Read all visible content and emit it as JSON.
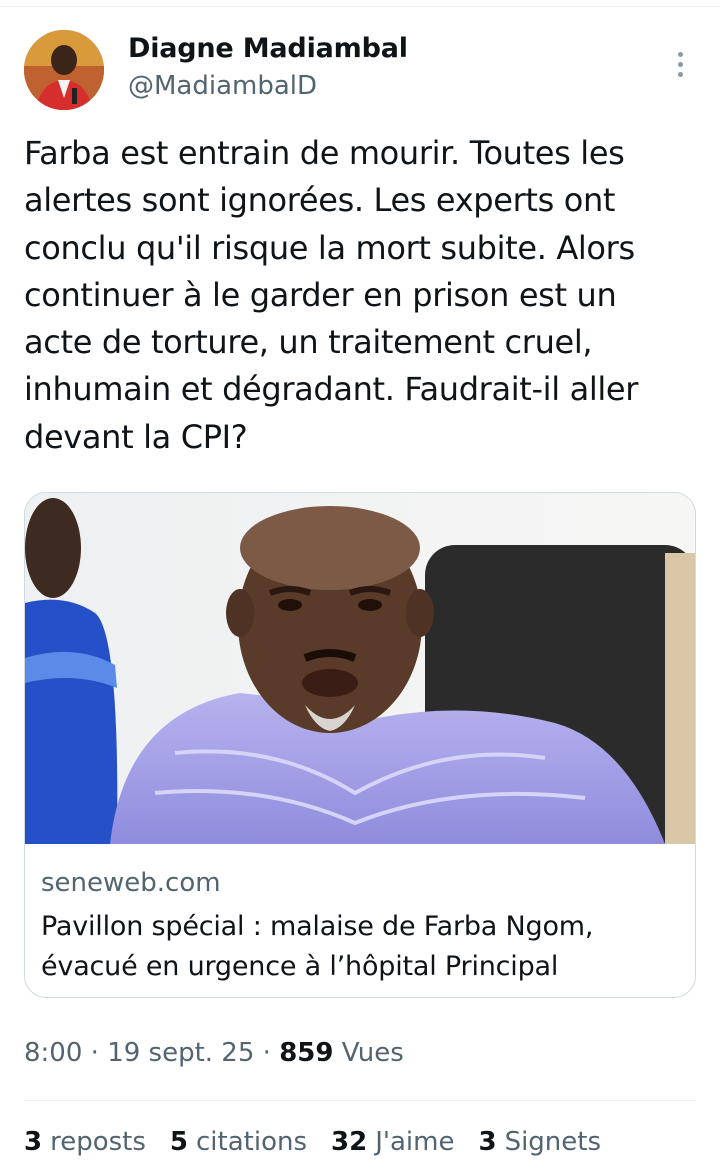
{
  "author": {
    "name": "Diagne Madiambal",
    "handle": "@MadiambalD"
  },
  "tweet": {
    "lines": [
      "Farba est entrain de mourir. Toutes les",
      "alertes sont ignorées. Les experts ont",
      "conclu qu'il risque la mort subite. Alors",
      "continuer à le garder en prison est un",
      "acte de torture, un traitement cruel,",
      "inhumain et dégradant. Faudrait-il aller",
      "devant la CPI?"
    ]
  },
  "link_card": {
    "domain": "seneweb.com",
    "title_lines": [
      "Pavillon spécial : malaise de Farba Ngom,",
      "évacué en urgence à l’hôpital Principal"
    ]
  },
  "meta": {
    "time": "8:00",
    "separator": " · ",
    "date": "19 sept. 25",
    "views_count": "859",
    "views_label": "Vues"
  },
  "stats": {
    "reposts": {
      "count": "3",
      "label": "reposts"
    },
    "quotes": {
      "count": "5",
      "label": "citations"
    },
    "likes": {
      "count": "32",
      "label": "J'aime"
    },
    "bookmarks": {
      "count": "3",
      "label": "Signets"
    }
  },
  "icons": {
    "more": "more-vertical-icon"
  },
  "colors": {
    "text_primary": "#0f1419",
    "text_secondary": "#536471",
    "border": "#cfd9de",
    "divider": "#eff3f4"
  }
}
